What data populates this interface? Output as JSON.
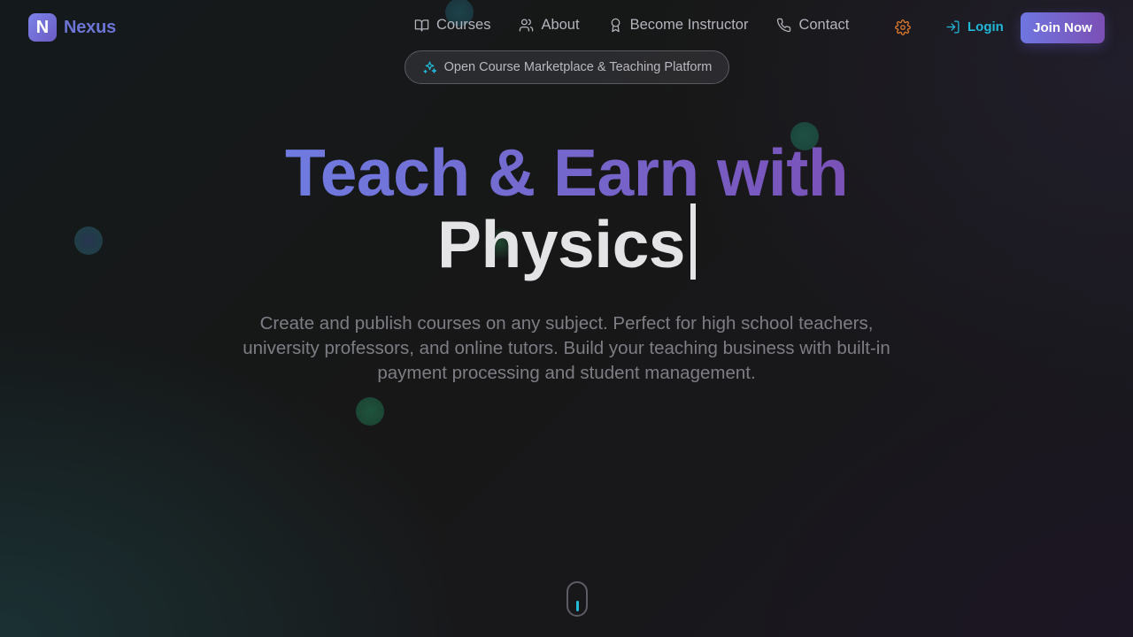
{
  "brand": {
    "logo_letter": "N",
    "name": "Nexus"
  },
  "nav": {
    "links": [
      {
        "label": "Courses",
        "icon": "book-open-icon"
      },
      {
        "label": "About",
        "icon": "users-icon"
      },
      {
        "label": "Become Instructor",
        "icon": "award-icon"
      },
      {
        "label": "Contact",
        "icon": "phone-icon"
      }
    ],
    "settings_icon": "gear-icon",
    "login_label": "Login",
    "join_label": "Join Now"
  },
  "badge": {
    "icon": "sparkles-icon",
    "text": "Open Course Marketplace & Teaching Platform"
  },
  "hero": {
    "title_line1": "Teach & Earn with",
    "title_line2": "Physics",
    "description": "Create and publish courses on any subject. Perfect for high school teachers, university professors, and online tutors. Build your teaching business with built-in payment processing and student management."
  },
  "colors": {
    "accent_cyan": "#22b8d8",
    "brand_gradient_start": "#6f76e0",
    "brand_gradient_end": "#7b4fb4",
    "settings_orange": "#d9772b"
  }
}
